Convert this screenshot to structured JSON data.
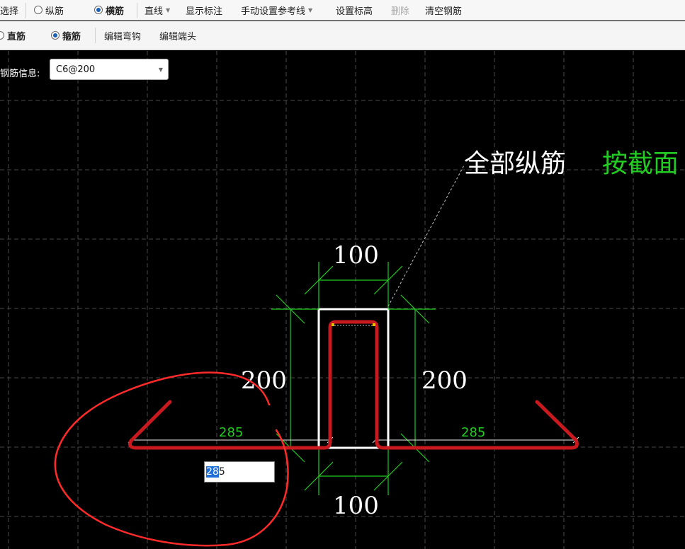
{
  "toolbar1": {
    "select_label": "选择",
    "longitudinal_label": "纵筋",
    "transverse_label": "横筋",
    "line_label": "直线",
    "show_dimension_label": "显示标注",
    "manual_reference_label": "手动设置参考线",
    "set_elevation_label": "设置标高",
    "delete_label": "删除",
    "clear_rebar_label": "清空钢筋"
  },
  "toolbar2": {
    "straight_label": "直筋",
    "stirrup_label": "箍筋",
    "edit_hook_label": "编辑弯钩",
    "edit_end_label": "编辑端头"
  },
  "rebar_info": {
    "label": "钢筋信息:",
    "value": "C6@200"
  },
  "drawing": {
    "annotation_white": "全部纵筋",
    "annotation_green": "按截面",
    "dim_top": "100",
    "dim_bottom": "100",
    "dim_left": "200",
    "dim_right": "200",
    "dim_left_leg": "285",
    "dim_right_leg": "285"
  },
  "edit_input": {
    "selected_text": "28",
    "rest_text": "5"
  },
  "colors": {
    "background": "#000000",
    "grid": "#4a4a4a",
    "rebar": "#c8191e",
    "dimension": "#22cc22",
    "outline": "#ffffff",
    "annotation": "#ffffff",
    "highlight": "#1e6fd8"
  }
}
